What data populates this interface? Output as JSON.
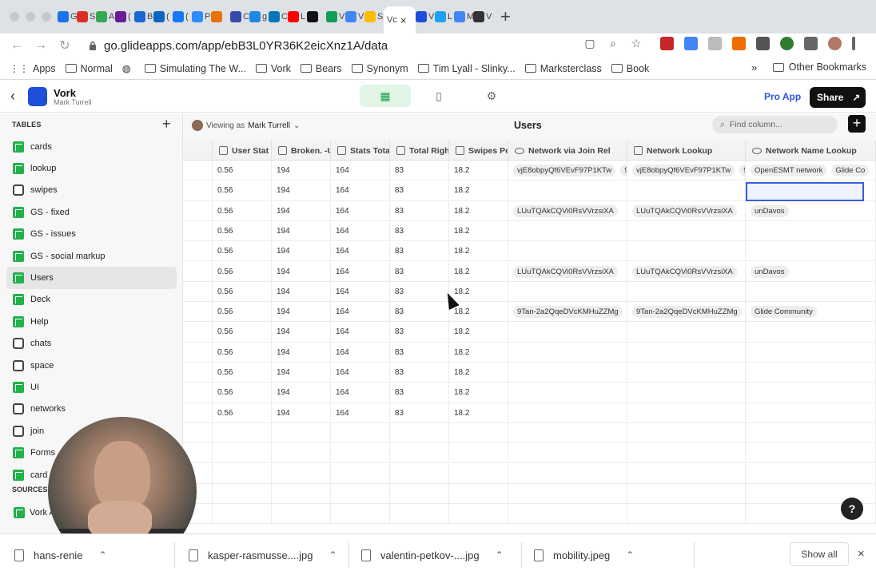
{
  "browser": {
    "url": "go.glideapps.com/app/ebB3L0YR36K2eicXnz1A/data",
    "tabs": [
      {
        "label": "G",
        "color": "#1a73e8"
      },
      {
        "label": "S",
        "color": "#d93025"
      },
      {
        "label": "A",
        "color": "#34a853"
      },
      {
        "label": "(",
        "color": "#6a1b9a"
      },
      {
        "label": "B",
        "color": "#1967d2"
      },
      {
        "label": "(",
        "color": "#0a66c2"
      },
      {
        "label": "(",
        "color": "#1877f2"
      },
      {
        "label": "P",
        "color": "#2d8cff"
      },
      {
        "label": "",
        "color": "#e8710a"
      },
      {
        "label": "C",
        "color": "#3949ab"
      },
      {
        "label": "g",
        "color": "#1e88e5"
      },
      {
        "label": "C",
        "color": "#0277bd"
      },
      {
        "label": "L",
        "color": "#ff0000"
      },
      {
        "label": "",
        "color": "#111111"
      },
      {
        "label": "V",
        "color": "#0f9d58"
      },
      {
        "label": "V",
        "color": "#4285f4"
      },
      {
        "label": "S",
        "color": "#fbbc04"
      }
    ],
    "active_tab": {
      "label": "Vc",
      "close": "×"
    },
    "tabs_after": [
      {
        "label": "V",
        "color": "#1d4fd8"
      },
      {
        "label": "L",
        "color": "#1da1f2"
      },
      {
        "label": "M",
        "color": "#4285f4"
      },
      {
        "label": "V",
        "color": "#333333"
      }
    ],
    "new_tab": "+",
    "bookmarks": [
      "Apps",
      "Normal",
      "",
      "Simulating The W...",
      "Vork",
      "Bears",
      "Synonym",
      "Tim Lyall - Slinky...",
      "Marksterclass",
      "Book"
    ],
    "bookmarks_more": "»",
    "other_bookmarks": "Other Bookmarks"
  },
  "app": {
    "name": "Vork",
    "owner": "Mark Turrell",
    "pro_app": "Pro App",
    "share": "Share"
  },
  "sidebar": {
    "tables_title": "TABLES",
    "add": "+",
    "items": [
      {
        "label": "cards",
        "icon": "sheet"
      },
      {
        "label": "lookup",
        "icon": "sheet"
      },
      {
        "label": "swipes",
        "icon": "rel"
      },
      {
        "label": "GS - fixed",
        "icon": "sheet"
      },
      {
        "label": "GS - issues",
        "icon": "sheet"
      },
      {
        "label": "GS - social markup",
        "icon": "sheet"
      },
      {
        "label": "Users",
        "icon": "sheet",
        "active": true
      },
      {
        "label": "Deck",
        "icon": "sheet"
      },
      {
        "label": "Help",
        "icon": "sheet"
      },
      {
        "label": "chats",
        "icon": "rel"
      },
      {
        "label": "space",
        "icon": "rel"
      },
      {
        "label": "UI",
        "icon": "sheet"
      },
      {
        "label": "networks",
        "icon": "rel"
      },
      {
        "label": "join",
        "icon": "rel"
      },
      {
        "label": "Forms",
        "icon": "sheet"
      },
      {
        "label": "card s",
        "icon": "sheet"
      }
    ],
    "sources_title": "SOURCES",
    "source": "Vork A"
  },
  "grid": {
    "viewing_as_prefix": "Viewing as",
    "viewing_as_user": "Mark Turrell",
    "title": "Users",
    "find_placeholder": "Find column...",
    "columns": [
      "User Stat F",
      "Broken. -U",
      "Stats Total",
      "Total Right",
      "Swipes Pe",
      "Network via Join Rel",
      "Network Lookup",
      "Network Name Lookup"
    ],
    "rows": [
      {
        "c1": "0.56",
        "c2": "194",
        "c3": "164",
        "c4": "83",
        "c5": "18.2",
        "c6": "vjE8obpyQf6VEvF97P1KTw",
        "c6b": "9",
        "c7": "vjE8obpyQf6VEvF97P1KTw",
        "c7b": "9",
        "c8": "OpenESMT network",
        "c8b": "Glide Co"
      },
      {
        "c1": "0.56",
        "c2": "194",
        "c3": "164",
        "c4": "83",
        "c5": "18.2",
        "c6": "",
        "c6b": "",
        "c7": "",
        "c7b": "",
        "c8": "",
        "c8b": ""
      },
      {
        "c1": "0.56",
        "c2": "194",
        "c3": "164",
        "c4": "83",
        "c5": "18.2",
        "c6": "LUuTQAkCQVi0RsVVrzsiXA",
        "c6b": "",
        "c7": "LUuTQAkCQVi0RsVVrzsiXA",
        "c7b": "",
        "c8": "unDavos",
        "c8b": ""
      },
      {
        "c1": "0.56",
        "c2": "194",
        "c3": "164",
        "c4": "83",
        "c5": "18.2",
        "c6": "",
        "c6b": "",
        "c7": "",
        "c7b": "",
        "c8": "",
        "c8b": ""
      },
      {
        "c1": "0.56",
        "c2": "194",
        "c3": "164",
        "c4": "83",
        "c5": "18.2",
        "c6": "",
        "c6b": "",
        "c7": "",
        "c7b": "",
        "c8": "",
        "c8b": ""
      },
      {
        "c1": "0.56",
        "c2": "194",
        "c3": "164",
        "c4": "83",
        "c5": "18.2",
        "c6": "LUuTQAkCQVi0RsVVrzsiXA",
        "c6b": "",
        "c7": "LUuTQAkCQVi0RsVVrzsiXA",
        "c7b": "",
        "c8": "unDavos",
        "c8b": ""
      },
      {
        "c1": "0.56",
        "c2": "194",
        "c3": "164",
        "c4": "83",
        "c5": "18.2",
        "c6": "",
        "c6b": "",
        "c7": "",
        "c7b": "",
        "c8": "",
        "c8b": ""
      },
      {
        "c1": "0.56",
        "c2": "194",
        "c3": "164",
        "c4": "83",
        "c5": "18.2",
        "c6": "9Tan-2a2QqeDVcKMHuZZMg",
        "c6b": "",
        "c7": "9Tan-2a2QqeDVcKMHuZZMg",
        "c7b": "",
        "c8": "Glide Community",
        "c8b": ""
      },
      {
        "c1": "0.56",
        "c2": "194",
        "c3": "164",
        "c4": "83",
        "c5": "18.2",
        "c6": "",
        "c6b": "",
        "c7": "",
        "c7b": "",
        "c8": "",
        "c8b": ""
      },
      {
        "c1": "0.56",
        "c2": "194",
        "c3": "164",
        "c4": "83",
        "c5": "18.2",
        "c6": "",
        "c6b": "",
        "c7": "",
        "c7b": "",
        "c8": "",
        "c8b": ""
      },
      {
        "c1": "0.56",
        "c2": "194",
        "c3": "164",
        "c4": "83",
        "c5": "18.2",
        "c6": "",
        "c6b": "",
        "c7": "",
        "c7b": "",
        "c8": "",
        "c8b": ""
      },
      {
        "c1": "0.56",
        "c2": "194",
        "c3": "164",
        "c4": "83",
        "c5": "18.2",
        "c6": "",
        "c6b": "",
        "c7": "",
        "c7b": "",
        "c8": "",
        "c8b": ""
      },
      {
        "c1": "0.56",
        "c2": "194",
        "c3": "164",
        "c4": "83",
        "c5": "18.2",
        "c6": "",
        "c6b": "",
        "c7": "",
        "c7b": "",
        "c8": "",
        "c8b": ""
      }
    ]
  },
  "help": "?",
  "downloads": {
    "items": [
      "hans-renie",
      "kasper-rasmusse....jpg",
      "valentin-petkov-....jpg",
      "mobility.jpeg"
    ],
    "show_all": "Show all",
    "close": "×"
  },
  "colors": {
    "accent": "#1d4fd8",
    "green": "#22b14c",
    "selection": "#3b5bdb"
  }
}
